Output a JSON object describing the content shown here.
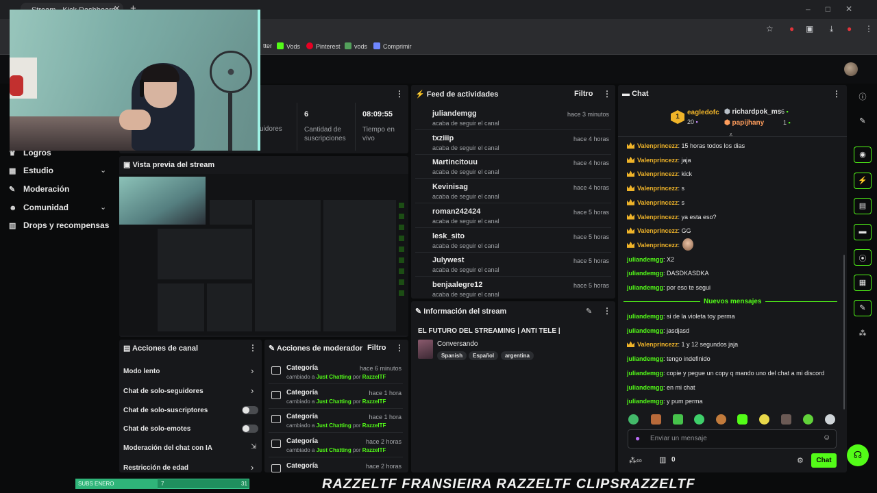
{
  "browser": {
    "tab_title": "Stream - Kick Dashboard",
    "bookmarks": [
      "tter",
      "Vods",
      "Pinterest",
      "vods",
      "Comprimir"
    ]
  },
  "sidebar": {
    "items": [
      {
        "label": "Logros"
      },
      {
        "label": "Estudio"
      },
      {
        "label": "Moderación"
      },
      {
        "label": "Comunidad"
      },
      {
        "label": "Drops y recompensas"
      }
    ]
  },
  "stats": {
    "followers_label": "uidores",
    "subs_value": "6",
    "subs_label": "Cantidad de suscripciones",
    "live_value": "08:09:55",
    "live_label": "Tiempo en vivo"
  },
  "preview": {
    "title": "Vista previa del stream"
  },
  "feed": {
    "title": "Feed de actividades",
    "filter": "Filtro",
    "items": [
      {
        "user": "juliandemgg",
        "action": "acaba de seguir el canal",
        "time": "hace 3 minutos"
      },
      {
        "user": "txziiip",
        "action": "acaba de seguir el canal",
        "time": "hace 4 horas"
      },
      {
        "user": "Martincitouu",
        "action": "acaba de seguir el canal",
        "time": "hace 4 horas"
      },
      {
        "user": "Kevinisag",
        "action": "acaba de seguir el canal",
        "time": "hace 4 horas"
      },
      {
        "user": "roman242424",
        "action": "acaba de seguir el canal",
        "time": "hace 5 horas"
      },
      {
        "user": "lesk_sito",
        "action": "acaba de seguir el canal",
        "time": "hace 5 horas"
      },
      {
        "user": "Julywest",
        "action": "acaba de seguir el canal",
        "time": "hace 5 horas"
      },
      {
        "user": "benjaalegre12",
        "action": "acaba de seguir el canal",
        "time": "hace 5 horas"
      }
    ]
  },
  "stream_info": {
    "title": "Información del stream",
    "stream_title": "EL FUTURO DEL STREAMING | ANTI TELE |",
    "category": "Conversando",
    "tags": [
      "Spanish",
      "Español",
      "argentina"
    ]
  },
  "channel_actions": {
    "title": "Acciones de canal",
    "items": [
      "Modo lento",
      "Chat de solo-seguidores",
      "Chat de solo-suscriptores",
      "Chat de solo-emotes",
      "Moderación del chat con IA",
      "Restricción de edad"
    ]
  },
  "mod_actions": {
    "title": "Acciones de moderador",
    "filter": "Filtro",
    "items": [
      {
        "title": "Categoría",
        "prefix": "cambiado a",
        "target": "Just Chatting",
        "by": "por",
        "user": "RazzelTF",
        "time": "hace 6 minutos"
      },
      {
        "title": "Categoría",
        "prefix": "cambiado a",
        "target": "Just Chatting",
        "by": "por",
        "user": "RazzelTF",
        "time": "hace 1 hora"
      },
      {
        "title": "Categoría",
        "prefix": "cambiado a",
        "target": "Just Chatting",
        "by": "por",
        "user": "RazzelTF",
        "time": "hace 1 hora"
      },
      {
        "title": "Categoría",
        "prefix": "cambiado a",
        "target": "Just Chatting",
        "by": "por",
        "user": "RazzelTF",
        "time": "hace 2 horas"
      },
      {
        "title": "Categoría",
        "prefix": "",
        "target": "",
        "by": "",
        "user": "",
        "time": "hace 2 horas"
      }
    ]
  },
  "chat": {
    "title": "Chat",
    "leaderboard": {
      "first": {
        "rank": "1",
        "user": "eagledofc",
        "count": "20"
      },
      "second": {
        "user": "richardpok_ms",
        "count": "6"
      },
      "third": {
        "user": "papijhany",
        "count": "1"
      }
    },
    "messages": [
      {
        "user": "Valenprincezz",
        "text": ": 15 horas todos los dias",
        "crown": true
      },
      {
        "user": "Valenprincezz",
        "text": ": jaja",
        "crown": true
      },
      {
        "user": "Valenprincezz",
        "text": ": kick",
        "crown": true
      },
      {
        "user": "Valenprincezz",
        "text": ": s",
        "crown": true
      },
      {
        "user": "Valenprincezz",
        "text": ": s",
        "crown": true
      },
      {
        "user": "Valenprincezz",
        "text": ": ya esta eso?",
        "crown": true
      },
      {
        "user": "Valenprincezz",
        "text": ": GG",
        "crown": true
      },
      {
        "user": "Valenprincezz",
        "text": ":",
        "crown": true
      },
      {
        "user": "juliandemgg",
        "text": ": X2",
        "crown": false
      },
      {
        "user": "juliandemgg",
        "text": ": DASDKASDKA",
        "crown": false
      },
      {
        "user": "juliandemgg",
        "text": ": por eso te segui",
        "crown": false
      }
    ],
    "new_messages_label": "Nuevos mensajes",
    "new_messages": [
      {
        "user": "juliandemgg",
        "text": ": si de la violeta toy perma",
        "crown": false
      },
      {
        "user": "juliandemgg",
        "text": ": jasdjasd",
        "crown": false
      },
      {
        "user": "Valenprincezz",
        "text": ": 1 y 12 segundos jaja",
        "crown": true
      },
      {
        "user": "juliandemgg",
        "text": ": tengo indefinido",
        "crown": false
      },
      {
        "user": "juliandemgg",
        "text": ": copie y pegue un copy q mando uno del chat a mi discord",
        "crown": false
      },
      {
        "user": "juliandemgg",
        "text": ": en mi chat",
        "crown": false
      },
      {
        "user": "juliandemgg",
        "text": ": y pum perma",
        "crown": false
      }
    ],
    "input_placeholder": "Enviar un mensaje",
    "points": "0",
    "send_label": "Chat"
  },
  "overlay": {
    "subs_label": "SUBS ENERO",
    "subs_current": "7",
    "subs_goal": "31",
    "banner": "RAZZELTF  FRANSIEIRA  RAZZELTF  CLIPSRAZZELTF"
  },
  "colors": {
    "accent": "#53fc18",
    "crown": "#f0b429",
    "panel": "#17181b",
    "background": "#0a0b0c"
  }
}
